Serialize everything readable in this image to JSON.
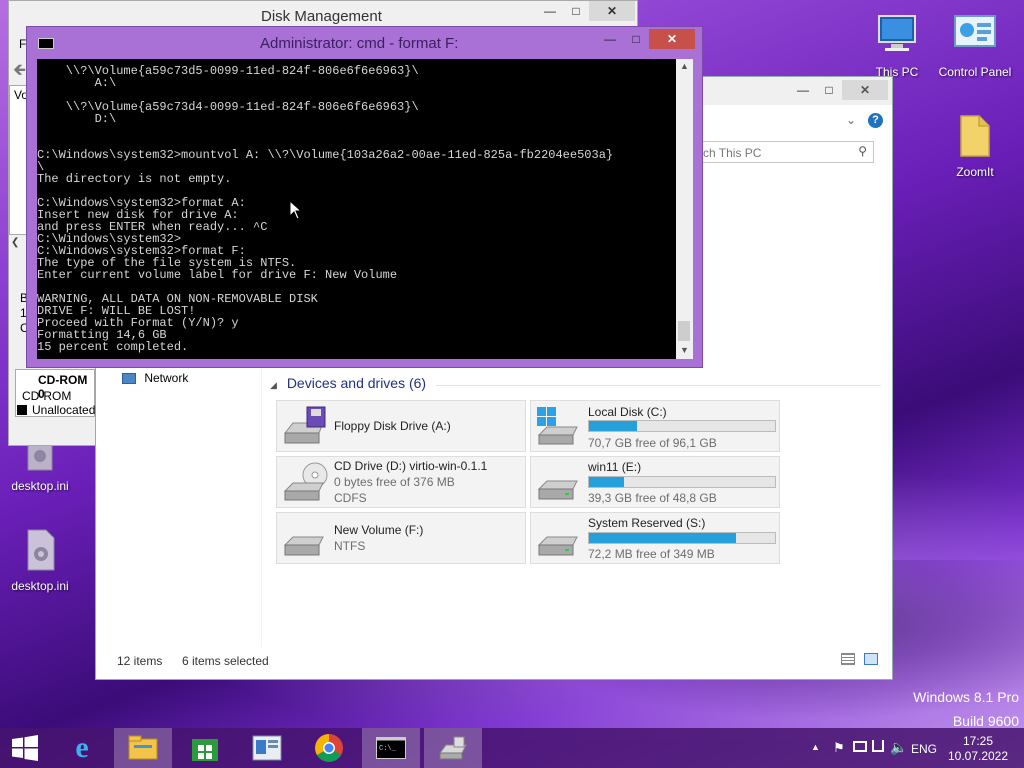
{
  "desktop": {
    "icons": [
      {
        "label": "This PC"
      },
      {
        "label": "Control Panel"
      },
      {
        "label": "ZoomIt"
      },
      {
        "label": "desktop.ini"
      },
      {
        "label": "desktop.ini"
      }
    ],
    "watermark_line1": "Windows 8.1 Pro",
    "watermark_line2": "Build 9600"
  },
  "disk_mgmt": {
    "title": "Disk Management",
    "menu_fragment": "Fi",
    "col_fragment": "Vo",
    "side_letters": [
      "B",
      "1",
      "C"
    ],
    "cdrom_label": "CD-ROM 0",
    "cdrom_sub": "CD-ROM",
    "unallocated": "Unallocated"
  },
  "cmd": {
    "title": "Administrator:  cmd - format  F:",
    "lines": [
      "    \\\\?\\Volume{a59c73d5-0099-11ed-824f-806e6f6e6963}\\",
      "        A:\\",
      "",
      "    \\\\?\\Volume{a59c73d4-0099-11ed-824f-806e6f6e6963}\\",
      "        D:\\",
      "",
      "",
      "C:\\Windows\\system32>mountvol A: \\\\?\\Volume{103a26a2-00ae-11ed-825a-fb2204ee503a}",
      "\\",
      "The directory is not empty.",
      "",
      "C:\\Windows\\system32>format A:",
      "Insert new disk for drive A:",
      "and press ENTER when ready... ^C",
      "C:\\Windows\\system32>",
      "C:\\Windows\\system32>format F:",
      "The type of the file system is NTFS.",
      "Enter current volume label for drive F: New Volume",
      "",
      "WARNING, ALL DATA ON NON-REMOVABLE DISK",
      "DRIVE F: WILL BE LOST!",
      "Proceed with Format (Y/N)? y",
      "Formatting 14,6 GB",
      "15 percent completed."
    ]
  },
  "explorer": {
    "search_placeholder": "ch This PC",
    "nav_network": "Network",
    "section_title": "Devices and drives (6)",
    "drives": [
      {
        "name": "Floppy Disk Drive (A:)",
        "sub1": "",
        "sub2": "",
        "usage": null
      },
      {
        "name": "Local Disk (C:)",
        "sub1": "70,7 GB free of 96,1 GB",
        "sub2": "",
        "usage": 0.26
      },
      {
        "name": "CD Drive (D:) virtio-win-0.1.1",
        "sub1": "0 bytes free of 376 MB",
        "sub2": "CDFS",
        "usage": null
      },
      {
        "name": "win11 (E:)",
        "sub1": "39,3 GB free of 48,8 GB",
        "sub2": "",
        "usage": 0.19
      },
      {
        "name": "New Volume (F:)",
        "sub1": "NTFS",
        "sub2": "",
        "usage": null
      },
      {
        "name": "System Reserved (S:)",
        "sub1": "72,2 MB free of 349 MB",
        "sub2": "",
        "usage": 0.79
      }
    ],
    "status_items": "12 items",
    "status_selected": "6 items selected"
  },
  "taskbar": {
    "lang": "ENG",
    "time": "17:25",
    "date": "10.07.2022"
  }
}
